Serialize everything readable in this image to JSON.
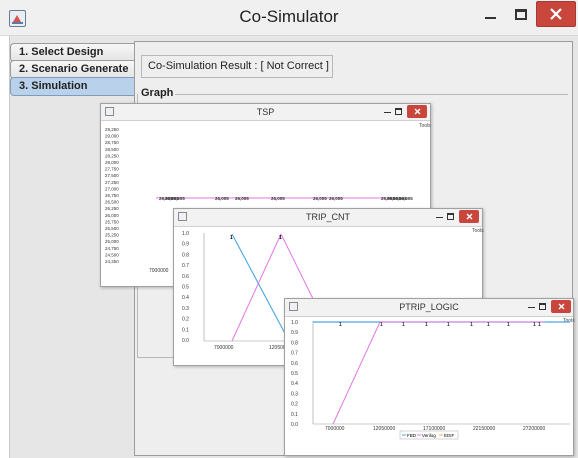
{
  "window": {
    "title": "Co-Simulator"
  },
  "tabs": [
    {
      "label": "1. Select Design",
      "active": false
    },
    {
      "label": "2. Scenario Generate",
      "active": false
    },
    {
      "label": "3. Simulation",
      "active": true
    }
  ],
  "result": {
    "text": "Co-Simulation Result : [ Not Correct ]"
  },
  "graph": {
    "label": "Graph"
  },
  "tools_label": "Tools",
  "frames": {
    "tsp": {
      "title": "TSP",
      "y_ticks": [
        "29,250",
        "29,000",
        "28,750",
        "28,500",
        "28,250",
        "28,000",
        "27,750",
        "27,500",
        "27,250",
        "27,000",
        "26,750",
        "26,500",
        "26,250",
        "26,000",
        "25,750",
        "25,500",
        "25,250",
        "25,000",
        "24,750",
        "24,500",
        "24,250"
      ],
      "x_tick": "7000000",
      "point_labels": [
        "26,005",
        "26,005",
        "26,005",
        "26,005",
        "26,005",
        "26,005",
        "26,005",
        "26,005",
        "26,005",
        "26,005",
        "26,005",
        "26,005"
      ],
      "line_color": "#e377e3"
    },
    "trip_cnt": {
      "title": "TRIP_CNT",
      "y_ticks": [
        "1.0",
        "0.9",
        "0.8",
        "0.7",
        "0.6",
        "0.5",
        "0.4",
        "0.3",
        "0.2",
        "0.1",
        "0.0"
      ],
      "x_ticks": [
        "7000000",
        "12050000"
      ],
      "point_labels": [
        "1",
        "1"
      ],
      "series_colors": [
        "#4aa8e0",
        "#e377e3"
      ]
    },
    "ptrip_logic": {
      "title": "PTRIP_LOGIC",
      "y_ticks": [
        "1.0",
        "0.9",
        "0.8",
        "0.7",
        "0.6",
        "0.5",
        "0.4",
        "0.3",
        "0.2",
        "0.1",
        "0.0"
      ],
      "x_ticks": [
        "7000000",
        "12050000",
        "17100000",
        "22150000",
        "27200000"
      ],
      "point_labels": [
        "1",
        "1",
        "1",
        "1",
        "1",
        "1",
        "1",
        "1",
        "1",
        "1"
      ],
      "legend": [
        "FBD",
        "Verilog",
        "EDIF"
      ],
      "series_colors": [
        "#4aa8e0",
        "#e377e3",
        "#f2b441"
      ]
    }
  },
  "colors": {
    "close_red": "#c9463d",
    "active_tab": "#b9d1ea"
  }
}
